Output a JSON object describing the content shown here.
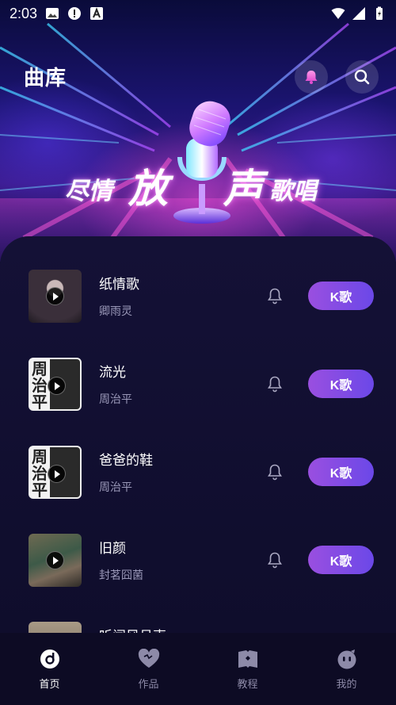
{
  "status_bar": {
    "time": "2:03"
  },
  "header": {
    "title": "曲库"
  },
  "slogan": {
    "part1": "尽情",
    "part2": "放",
    "part3": "声",
    "part4": "歌唱"
  },
  "songs": [
    {
      "title": "纸情歌",
      "artist": "卿雨灵",
      "button": "K歌",
      "cover_text": ""
    },
    {
      "title": "流光",
      "artist": "周治平",
      "button": "K歌",
      "cover_text": "周治平"
    },
    {
      "title": "爸爸的鞋",
      "artist": "周治平",
      "button": "K歌",
      "cover_text": "周治平"
    },
    {
      "title": "旧颜",
      "artist": "封茗囧菌",
      "button": "K歌",
      "cover_text": ""
    },
    {
      "title": "听闻风吕声",
      "artist": "",
      "button": "",
      "cover_text": ""
    }
  ],
  "nav": [
    {
      "label": "首页",
      "icon": "home-disc-icon",
      "active": true
    },
    {
      "label": "作品",
      "icon": "heart-icon",
      "active": false
    },
    {
      "label": "教程",
      "icon": "book-icon",
      "active": false
    },
    {
      "label": "我的",
      "icon": "profile-face-icon",
      "active": false
    }
  ],
  "colors": {
    "accent_start": "#9a4fe0",
    "accent_end": "#6b48e8",
    "background": "#0d0b24"
  }
}
